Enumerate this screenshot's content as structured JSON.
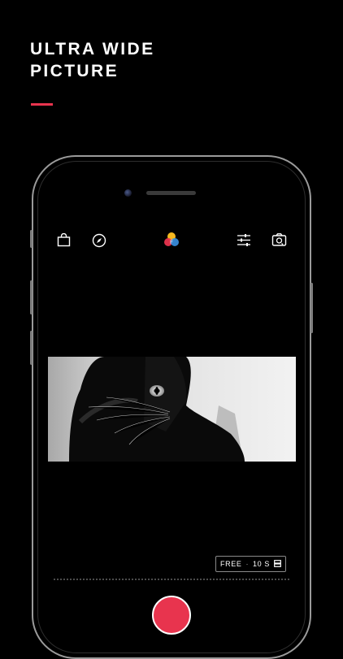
{
  "headline": {
    "line1": "ULTRA WIDE",
    "line2": "PICTURE"
  },
  "colors": {
    "accent": "#e8344e",
    "background": "#000000",
    "phone_frame": "#9a9a9a"
  },
  "toolbar": {
    "left_icons": [
      "shopping-bag-icon",
      "compass-icon"
    ],
    "center_icon": "filter-color-circles-icon",
    "right_icons": [
      "adjust-sliders-icon",
      "camera-switch-icon"
    ]
  },
  "preview": {
    "subject": "black-and-white cat photo (ultra wide crop)"
  },
  "mode_pill": {
    "mode": "FREE",
    "separator": "·",
    "duration": "10 S",
    "icon": "aspect-ratio-icon"
  }
}
